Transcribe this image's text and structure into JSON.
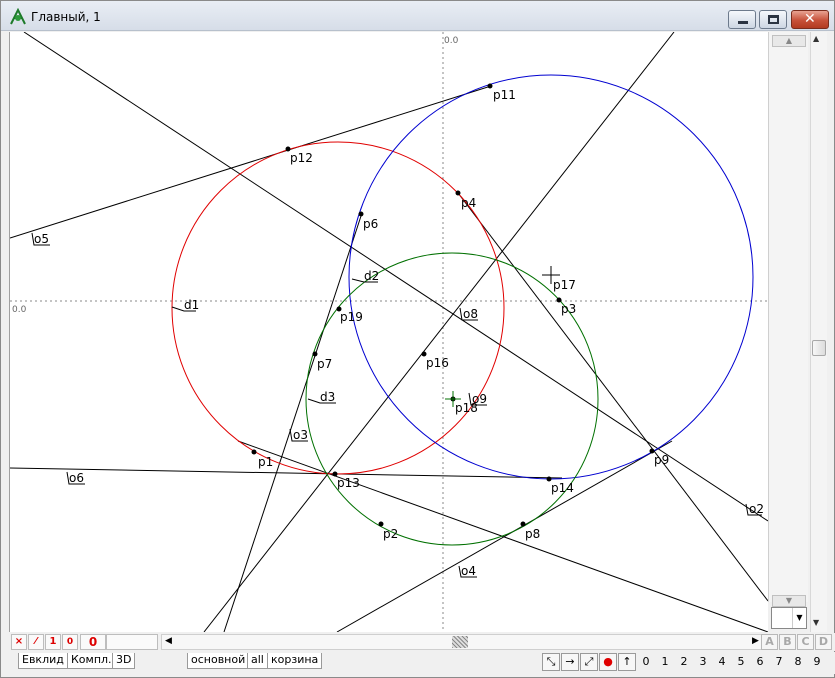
{
  "window": {
    "title": "Главный, 1",
    "colors": {
      "titlebar": "#dbe3ee",
      "close": "#c7513a"
    }
  },
  "axes": {
    "x_origin_label": "0.0",
    "y_origin_label": "0.0"
  },
  "points": [
    "p1",
    "p2",
    "p3",
    "p4",
    "p6",
    "p7",
    "p8",
    "p9",
    "p11",
    "p12",
    "p13",
    "p14",
    "p16",
    "p17",
    "p18",
    "p19"
  ],
  "line_labels": [
    "o2",
    "o3",
    "o4",
    "o5",
    "o6",
    "o8",
    "o9",
    "d1",
    "d2",
    "d3"
  ],
  "circles": [
    {
      "name": "red",
      "color": "#e00000"
    },
    {
      "name": "blue",
      "color": "#0000d0"
    },
    {
      "name": "green",
      "color": "#007000"
    }
  ],
  "toolbar": {
    "tool_cross": "×",
    "tool_line": "⁄",
    "tool_one": "1",
    "tool_zero_small": "0",
    "counter": "0"
  },
  "letters": [
    "A",
    "B",
    "C",
    "D"
  ],
  "tabs": [
    "Евклид",
    "Компл.",
    "3D",
    "основной",
    "all",
    "корзина"
  ],
  "tools": [
    "link-icon",
    "arrow-right-icon",
    "resize-icon",
    "record-icon",
    "arrow-up-icon"
  ],
  "digits": [
    "0",
    "1",
    "2",
    "3",
    "4",
    "5",
    "6",
    "7",
    "8",
    "9"
  ]
}
